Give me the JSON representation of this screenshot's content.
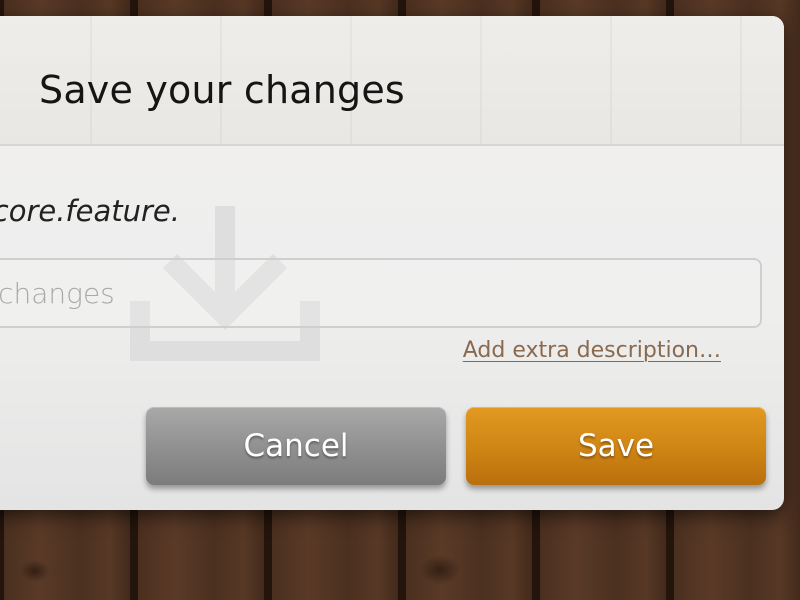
{
  "dialog": {
    "title": "Save your changes",
    "message_text": "core.feature.",
    "summary_placeholder": "Summary of changes",
    "extra_description_link": "Add extra description…",
    "cancel_label": "Cancel",
    "save_label": "Save"
  },
  "colors": {
    "save_button": "#d38a17",
    "cancel_button": "#949494",
    "link": "#8a6a4e",
    "background_wood": "#3b2417"
  },
  "icons": {
    "background_icon": "download-icon"
  }
}
